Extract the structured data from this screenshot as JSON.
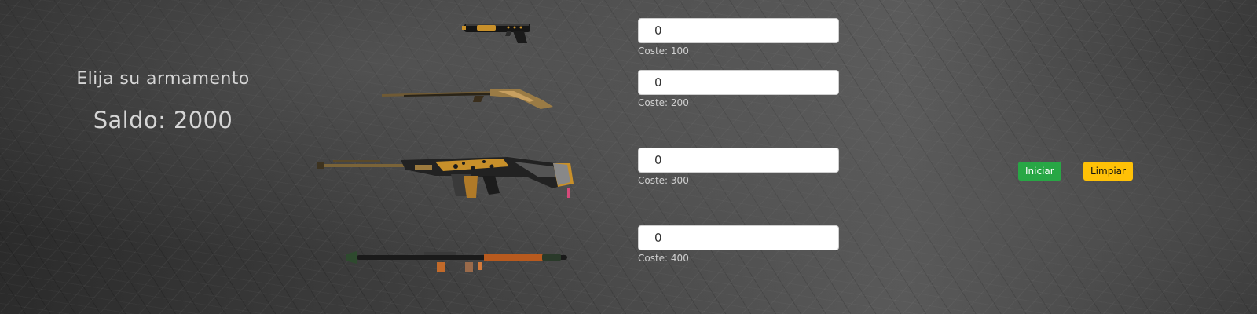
{
  "header": {
    "title": "Elija su armamento",
    "balance": "Saldo: 2000"
  },
  "weapons": [
    {
      "icon": "pistol-icon",
      "quantity": "0",
      "cost_label": "Coste: 100"
    },
    {
      "icon": "rifle-icon",
      "quantity": "0",
      "cost_label": "Coste: 200"
    },
    {
      "icon": "assault-rifle-icon",
      "quantity": "0",
      "cost_label": "Coste: 300"
    },
    {
      "icon": "rocket-launcher-icon",
      "quantity": "0",
      "cost_label": "Coste: 400"
    }
  ],
  "actions": {
    "start_label": "Iniciar",
    "clear_label": "Limpiar"
  },
  "colors": {
    "start_button": "#28a745",
    "clear_button": "#ffc107",
    "accent_gold": "#c8902a"
  }
}
